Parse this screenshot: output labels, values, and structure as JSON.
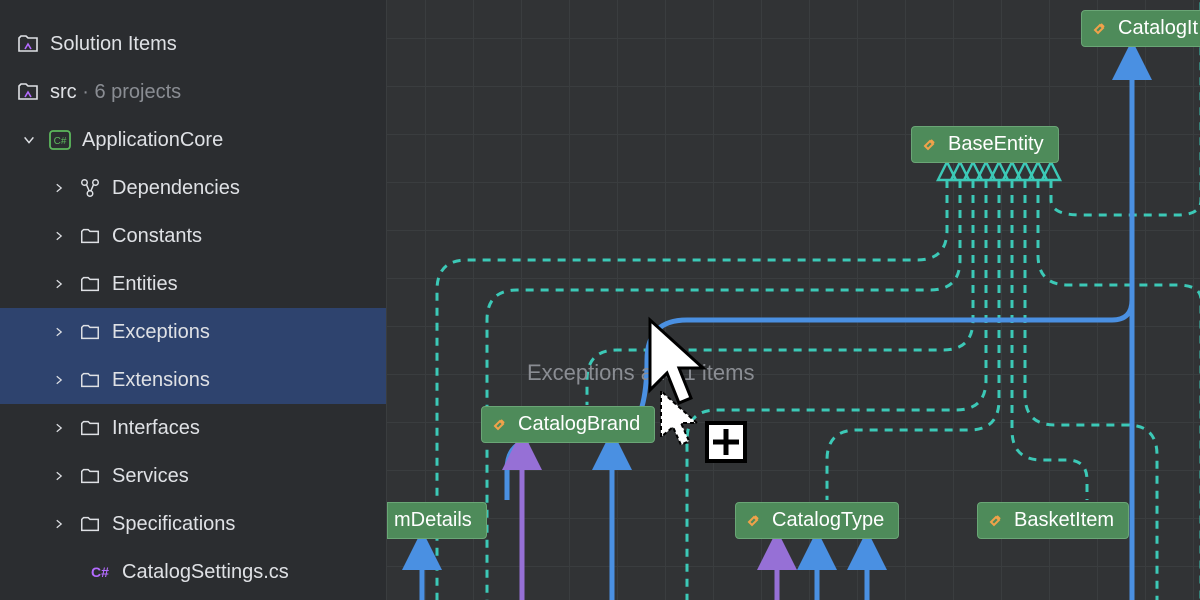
{
  "sidebar": {
    "solution_items": "Solution Items",
    "src": "src",
    "src_suffix": " · 6 projects",
    "project": "ApplicationCore",
    "items": [
      {
        "label": "Dependencies",
        "kind": "deps"
      },
      {
        "label": "Constants",
        "kind": "folder"
      },
      {
        "label": "Entities",
        "kind": "folder"
      },
      {
        "label": "Exceptions",
        "kind": "folder",
        "selected": true
      },
      {
        "label": "Extensions",
        "kind": "folder",
        "selected": true
      },
      {
        "label": "Interfaces",
        "kind": "folder"
      },
      {
        "label": "Services",
        "kind": "folder"
      },
      {
        "label": "Specifications",
        "kind": "folder"
      },
      {
        "label": "CatalogSettings.cs",
        "kind": "csfile"
      }
    ]
  },
  "canvas": {
    "ghost_text": "Exceptions and 1 items",
    "nodes": {
      "baseentity": "BaseEntity",
      "catalogbrand": "CatalogBrand",
      "catalogit": "CatalogIt",
      "mdetails": "mDetails",
      "catalogtype": "CatalogType",
      "basketitem": "BasketItem"
    }
  }
}
